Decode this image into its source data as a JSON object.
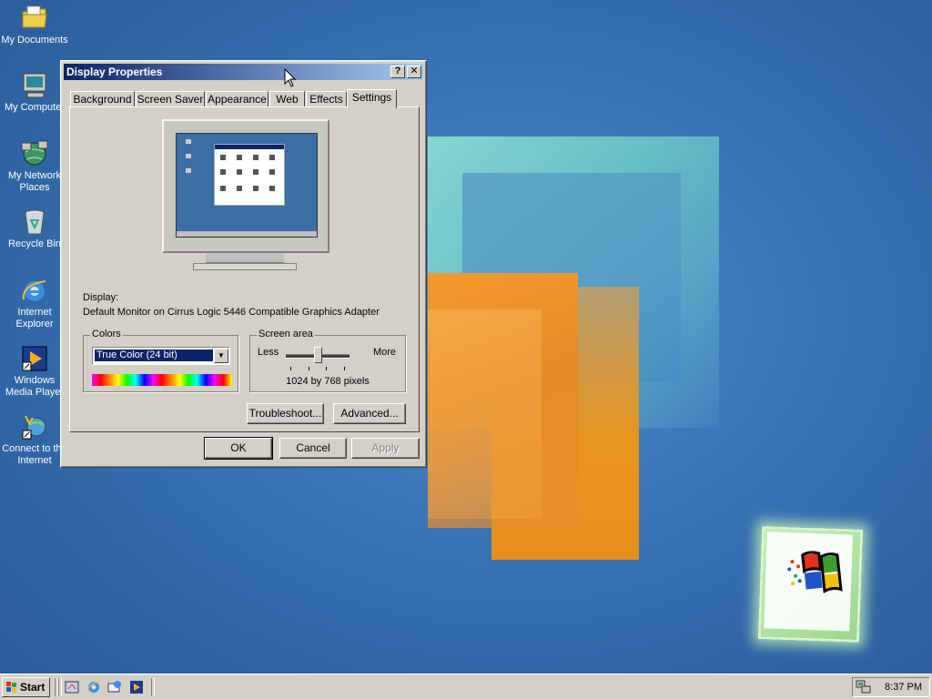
{
  "desktop": {
    "icons": [
      {
        "label": "My Documents"
      },
      {
        "label": "My Computer"
      },
      {
        "label": "My Network Places"
      },
      {
        "label": "Recycle Bin"
      },
      {
        "label": "Internet Explorer"
      },
      {
        "label": "Windows Media Player"
      },
      {
        "label": "Connect to the Internet"
      }
    ]
  },
  "dialog": {
    "title": "Display Properties",
    "help_glyph": "?",
    "close_glyph": "✕",
    "tabs": [
      "Background",
      "Screen Saver",
      "Appearance",
      "Web",
      "Effects",
      "Settings"
    ],
    "selected_tab": "Settings",
    "display_label": "Display:",
    "display_value": "Default Monitor on Cirrus Logic 5446 Compatible Graphics Adapter",
    "colors": {
      "group_label": "Colors",
      "selected": "True Color (24 bit)"
    },
    "screen_area": {
      "group_label": "Screen area",
      "less_label": "Less",
      "more_label": "More",
      "value_text": "1024 by 768 pixels",
      "slider_level": 0.5
    },
    "buttons": {
      "troubleshoot": "Troubleshoot...",
      "advanced": "Advanced...",
      "ok": "OK",
      "cancel": "Cancel",
      "apply": "Apply"
    }
  },
  "taskbar": {
    "start_label": "Start",
    "clock": "8:37 PM"
  },
  "colors": {
    "desktop": "#3a78b8",
    "title_active": "#0a246a",
    "face": "#d4d0c8"
  }
}
